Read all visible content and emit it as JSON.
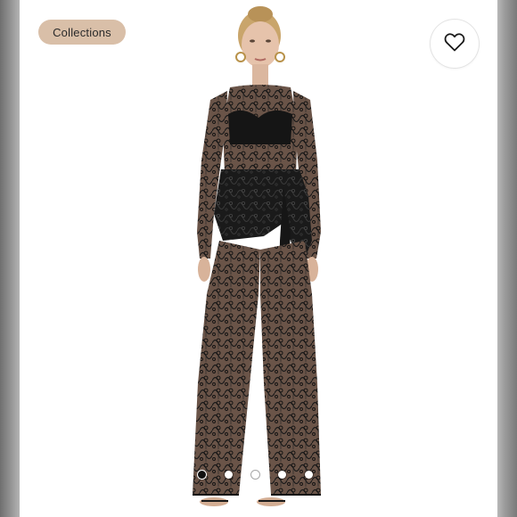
{
  "chip": {
    "label": "Collections"
  },
  "like": {
    "icon": "heart-icon"
  },
  "photo": {
    "subject": "product-photo"
  },
  "carousel": {
    "count": 5,
    "active_index": 0
  },
  "colors": {
    "chip_bg": "#d9bfa8",
    "lace": "#121212",
    "skin": "#d8b39a",
    "hair": "#c9a56b"
  }
}
